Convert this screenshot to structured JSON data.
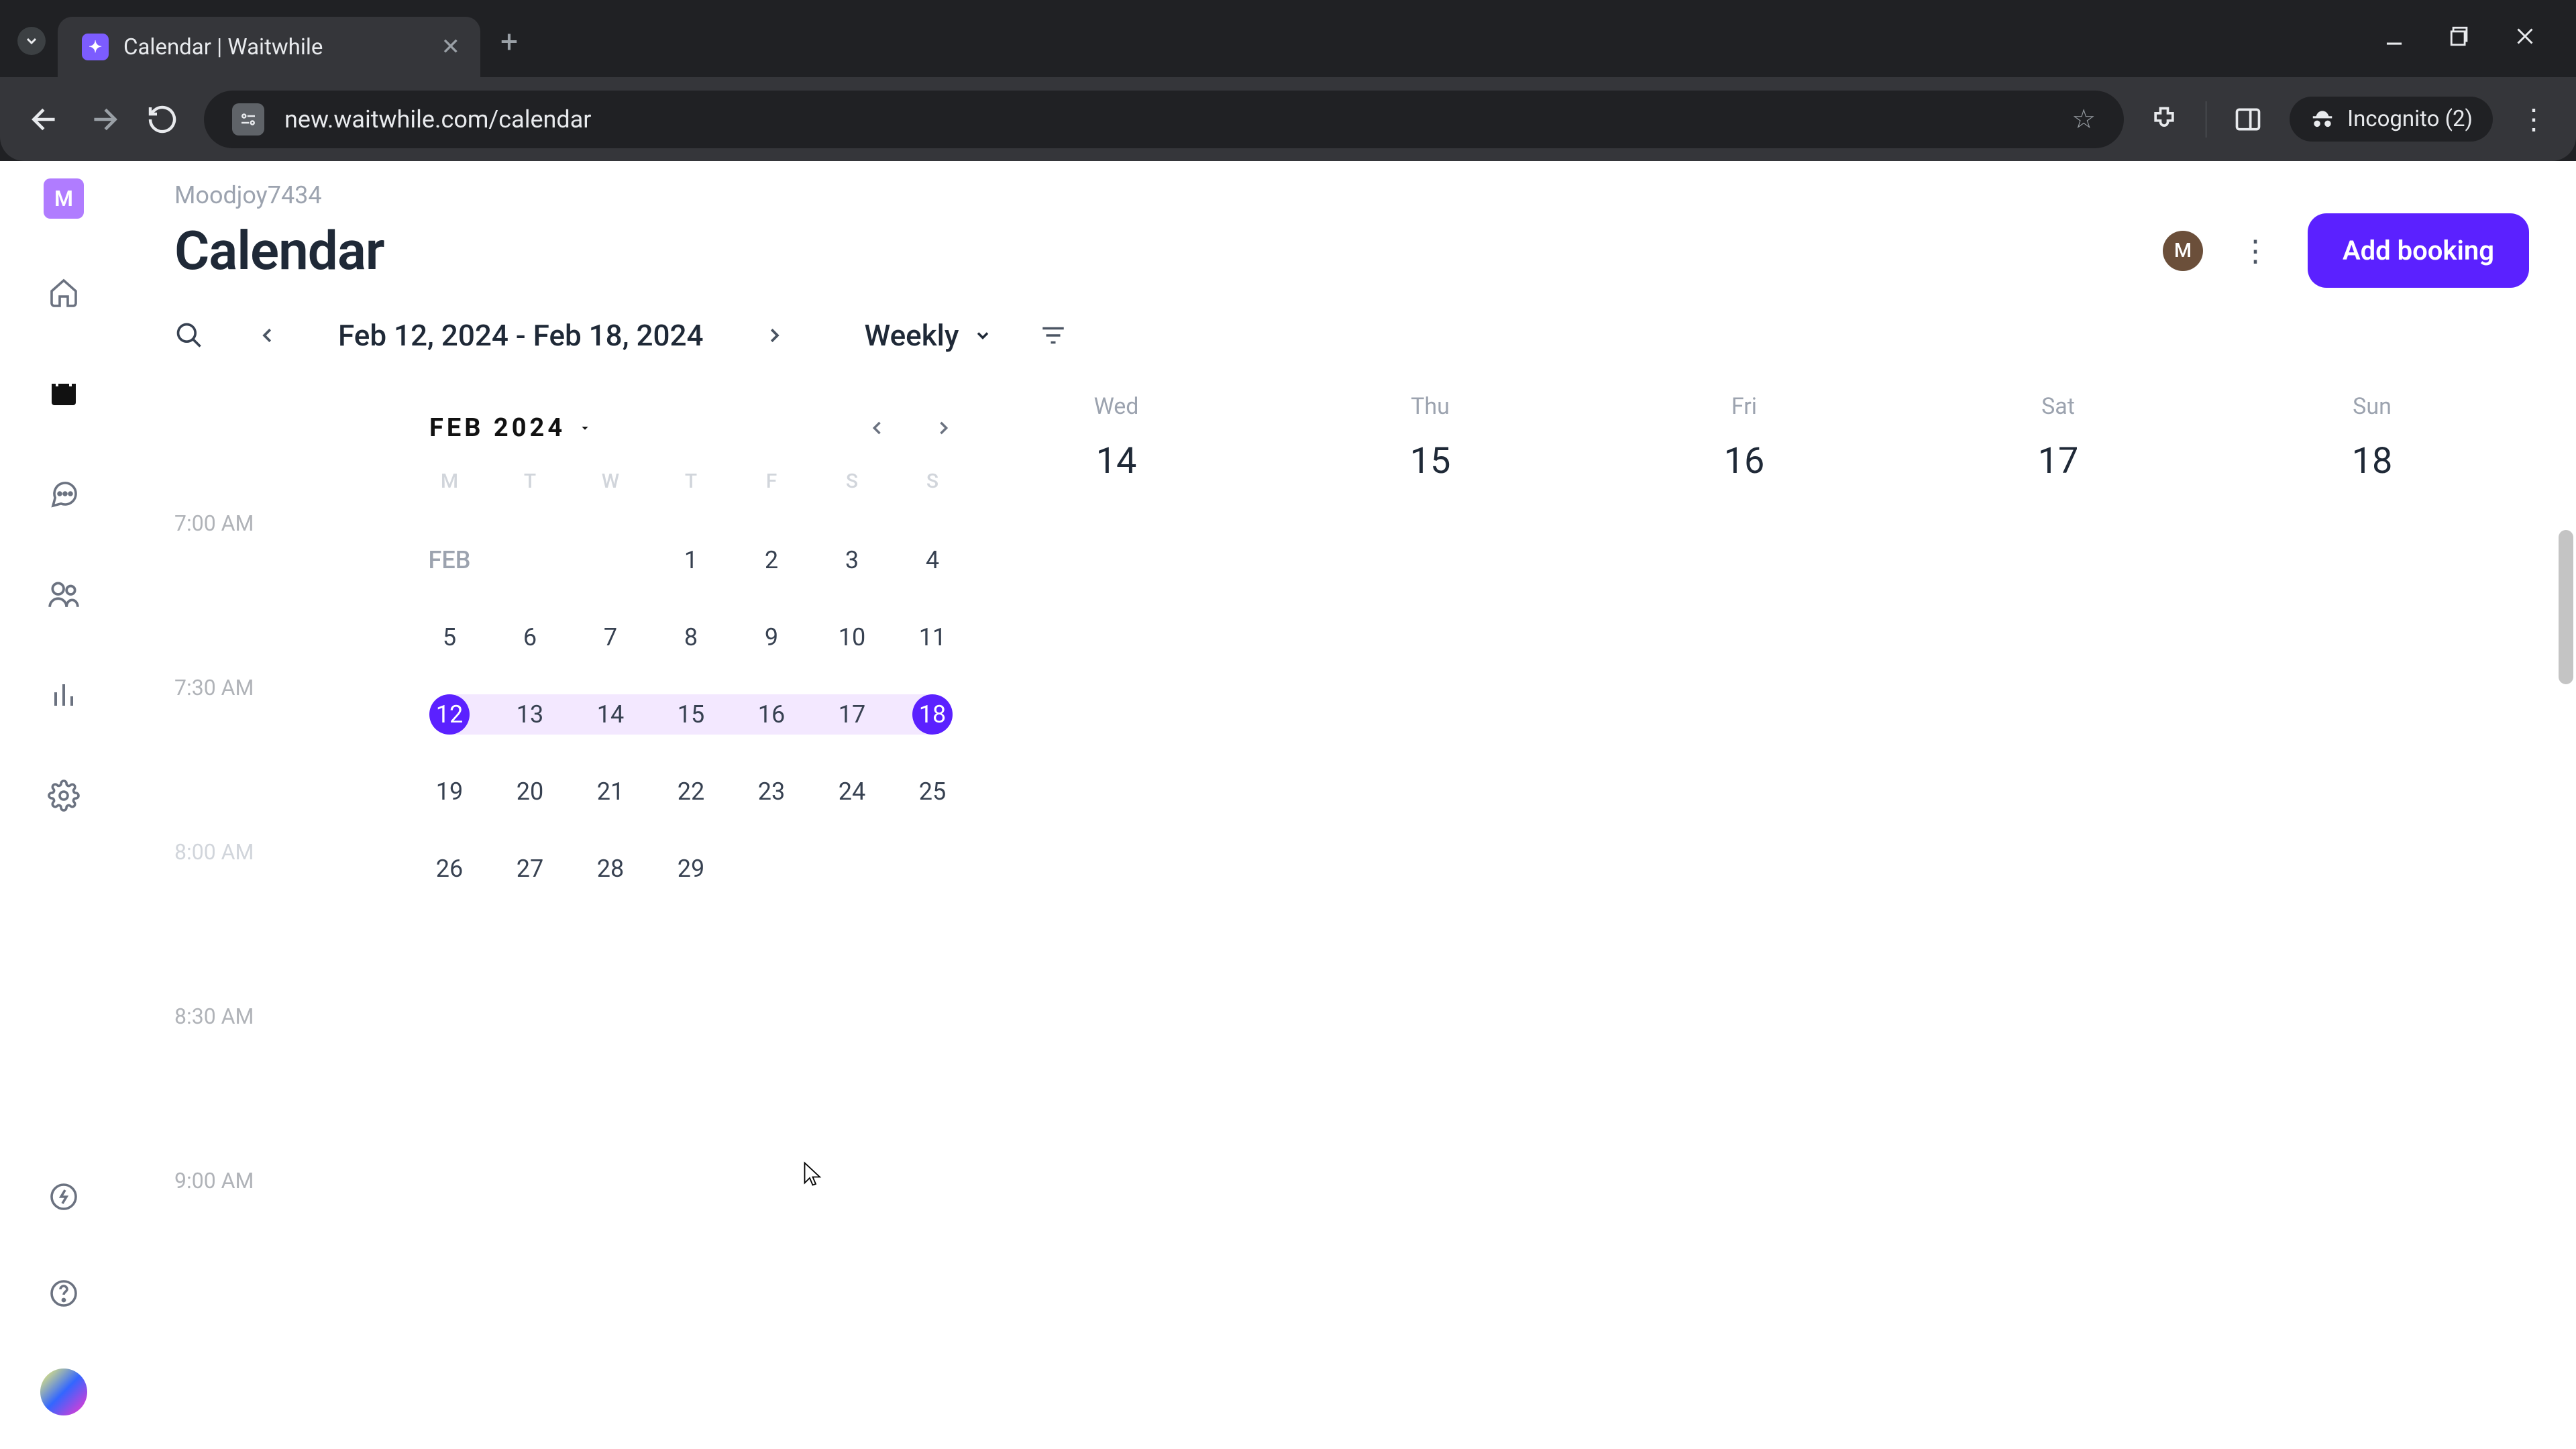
{
  "browser": {
    "tab_title": "Calendar | Waitwhile",
    "url": "new.waitwhile.com/calendar",
    "incognito_label": "Incognito (2)"
  },
  "sidebar": {
    "workspace_letter": "M"
  },
  "header": {
    "breadcrumb": "Moodjoy7434",
    "title": "Calendar",
    "avatar_letter": "M",
    "add_button": "Add booking"
  },
  "toolbar": {
    "range": "Feb 12, 2024 - Feb 18, 2024",
    "view": "Weekly"
  },
  "mini_calendar": {
    "month_label": "FEB 2024",
    "dow": [
      "M",
      "T",
      "W",
      "T",
      "F",
      "S",
      "S"
    ],
    "row_label": "FEB",
    "weeks": [
      [
        "",
        "",
        "",
        "1",
        "2",
        "3",
        "4"
      ],
      [
        "5",
        "6",
        "7",
        "8",
        "9",
        "10",
        "11"
      ],
      [
        "12",
        "13",
        "14",
        "15",
        "16",
        "17",
        "18"
      ],
      [
        "19",
        "20",
        "21",
        "22",
        "23",
        "24",
        "25"
      ],
      [
        "26",
        "27",
        "28",
        "29",
        "",
        "",
        ""
      ]
    ],
    "range_start": "12",
    "range_end": "18"
  },
  "day_headers": [
    {
      "dow": "Wed",
      "num": "14"
    },
    {
      "dow": "Thu",
      "num": "15"
    },
    {
      "dow": "Fri",
      "num": "16"
    },
    {
      "dow": "Sat",
      "num": "17"
    },
    {
      "dow": "Sun",
      "num": "18"
    }
  ],
  "time_slots": [
    "7:00 AM",
    "7:30 AM",
    "8:00 AM",
    "8:30 AM",
    "9:00 AM"
  ]
}
